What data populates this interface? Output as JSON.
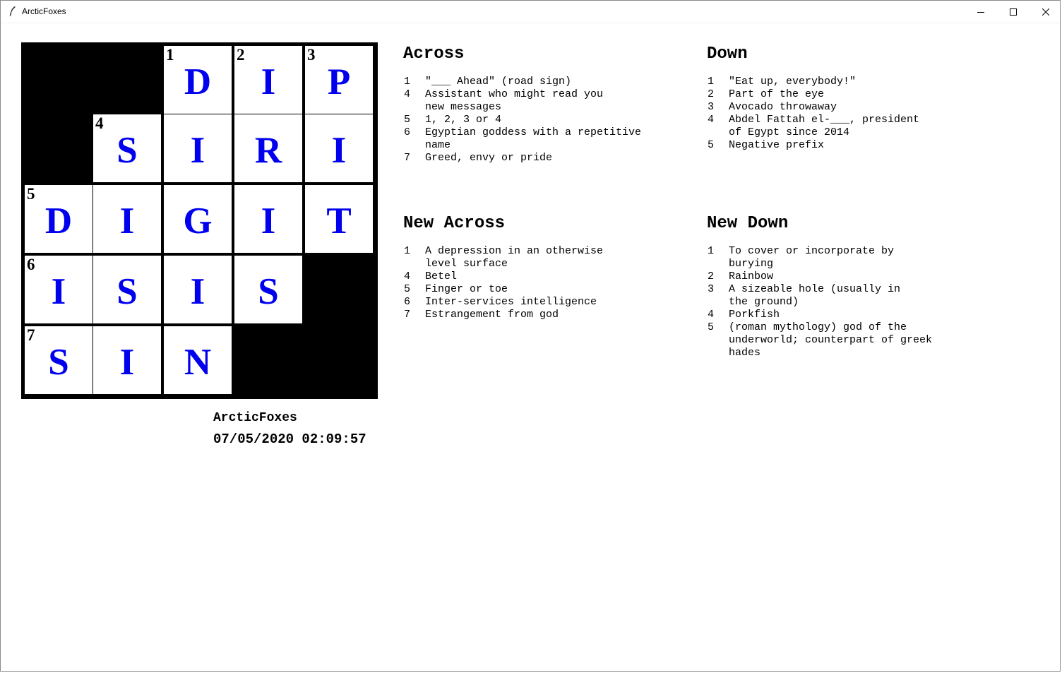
{
  "window": {
    "title": "ArcticFoxes",
    "icon": "feather-icon",
    "controls": [
      "minimize-icon",
      "maximize-icon",
      "close-icon"
    ]
  },
  "colors": {
    "letter": "#0000ee",
    "block": "#000000",
    "cell": "#ffffff"
  },
  "grid": {
    "rows": [
      [
        {
          "block": true
        },
        {
          "block": true
        },
        {
          "num": "1",
          "letter": "D"
        },
        {
          "num": "2",
          "letter": "I"
        },
        {
          "num": "3",
          "letter": "P"
        }
      ],
      [
        {
          "block": true
        },
        {
          "num": "4",
          "letter": "S"
        },
        {
          "letter": "I"
        },
        {
          "letter": "R"
        },
        {
          "letter": "I"
        }
      ],
      [
        {
          "num": "5",
          "letter": "D"
        },
        {
          "letter": "I"
        },
        {
          "letter": "G"
        },
        {
          "letter": "I"
        },
        {
          "letter": "T"
        }
      ],
      [
        {
          "num": "6",
          "letter": "I"
        },
        {
          "letter": "S"
        },
        {
          "letter": "I"
        },
        {
          "letter": "S"
        },
        {
          "block": true
        }
      ],
      [
        {
          "num": "7",
          "letter": "S"
        },
        {
          "letter": "I"
        },
        {
          "letter": "N"
        },
        {
          "block": true
        },
        {
          "block": true
        }
      ]
    ]
  },
  "footer": {
    "name": "ArcticFoxes",
    "datetime": "07/05/2020 02:09:57"
  },
  "across": {
    "heading": "Across",
    "clues": [
      {
        "num": "1",
        "text": "\"___ Ahead\" (road sign)"
      },
      {
        "num": "4",
        "text": "Assistant who might read you\nnew messages"
      },
      {
        "num": "5",
        "text": "1, 2, 3 or 4"
      },
      {
        "num": "6",
        "text": "Egyptian goddess with a repetitive\nname"
      },
      {
        "num": "7",
        "text": "Greed, envy or pride"
      }
    ]
  },
  "down": {
    "heading": "Down",
    "clues": [
      {
        "num": "1",
        "text": "\"Eat up, everybody!\""
      },
      {
        "num": "2",
        "text": "Part of the eye"
      },
      {
        "num": "3",
        "text": "Avocado throwaway"
      },
      {
        "num": "4",
        "text": "Abdel Fattah el-___, president\nof Egypt since 2014"
      },
      {
        "num": "5",
        "text": "Negative prefix"
      }
    ]
  },
  "new_across": {
    "heading": "New Across",
    "clues": [
      {
        "num": "1",
        "text": "A depression in an otherwise\nlevel surface"
      },
      {
        "num": "4",
        "text": "Betel"
      },
      {
        "num": "5",
        "text": "Finger or toe"
      },
      {
        "num": "6",
        "text": "Inter-services intelligence"
      },
      {
        "num": "7",
        "text": "Estrangement from god"
      }
    ]
  },
  "new_down": {
    "heading": "New Down",
    "clues": [
      {
        "num": "1",
        "text": "To cover or incorporate by\nburying"
      },
      {
        "num": "2",
        "text": "Rainbow"
      },
      {
        "num": "3",
        "text": "A sizeable hole (usually in\nthe ground)"
      },
      {
        "num": "4",
        "text": "Porkfish"
      },
      {
        "num": "5",
        "text": "(roman mythology) god of the\nunderworld; counterpart of greek\nhades"
      }
    ]
  }
}
